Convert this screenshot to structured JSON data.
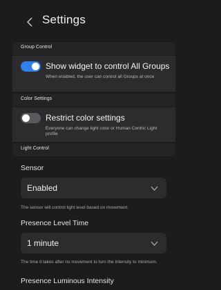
{
  "header": {
    "back_icon": "chevron-left-icon",
    "title": "Settings"
  },
  "group_control": {
    "section_label": "Group Control",
    "toggle_title": "Show widget to control All Groups",
    "toggle_desc": "When enabled, the user can control all Groups at once",
    "enabled": true
  },
  "color_settings": {
    "section_label": "Color Settings",
    "toggle_title": "Restrict color settings",
    "toggle_desc": "Everyone can change light color or Human Centric Light profile",
    "enabled": false
  },
  "light_control": {
    "section_label": "Light Control",
    "sensor": {
      "label": "Sensor",
      "value": "Enabled",
      "helper": "The sensor will control light level based on movement."
    },
    "presence_level_time": {
      "label": "Presence Level Time",
      "value": "1 minute",
      "helper": "The time it takes after no movement to turn the intensity to minimum."
    },
    "presence_luminous_intensity": {
      "label": "Presence Luminous Intensity"
    }
  },
  "colors": {
    "background": "#1c1c1e",
    "toggle_on": "#2f80ed",
    "toggle_off": "#5a5a5e",
    "row": "#2c2c2e"
  }
}
